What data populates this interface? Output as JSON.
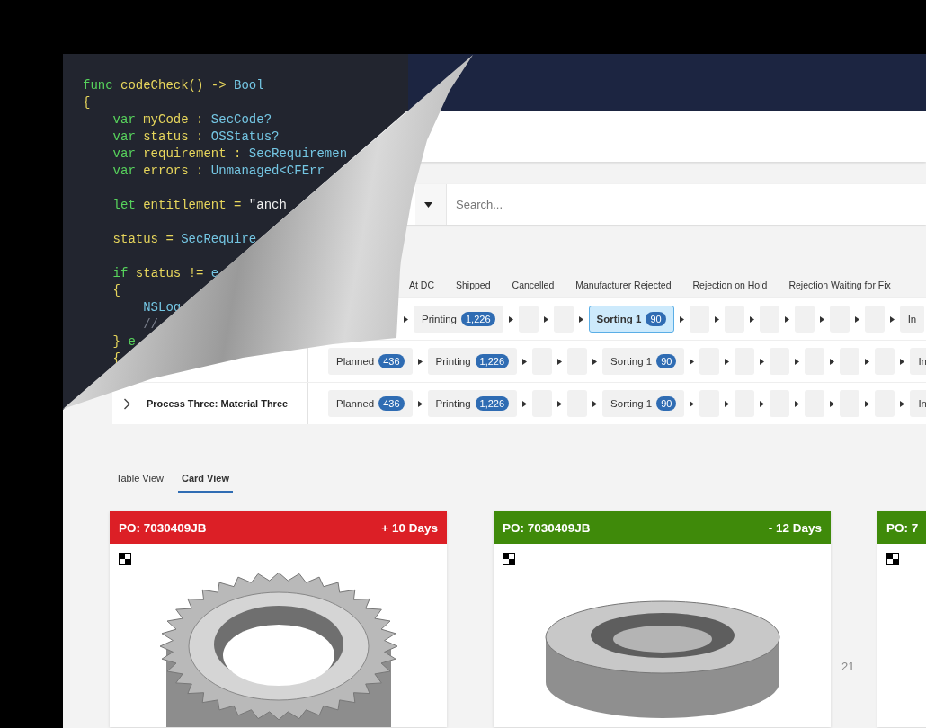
{
  "code_lines": [
    {
      "tokens": [
        {
          "text": "func",
          "kind": "keyword"
        },
        {
          "text": " codeCheck() -> ",
          "kind": "ident"
        },
        {
          "text": "Bool",
          "kind": "type"
        }
      ]
    },
    {
      "tokens": [
        {
          "text": "{",
          "kind": "ident"
        }
      ]
    },
    {
      "tokens": [
        {
          "text": "    var",
          "kind": "keyword"
        },
        {
          "text": " myCode : ",
          "kind": "ident"
        },
        {
          "text": "SecCode?",
          "kind": "type"
        }
      ]
    },
    {
      "tokens": [
        {
          "text": "    var",
          "kind": "keyword"
        },
        {
          "text": " status : ",
          "kind": "ident"
        },
        {
          "text": "OSStatus?",
          "kind": "type"
        }
      ]
    },
    {
      "tokens": [
        {
          "text": "    var",
          "kind": "keyword"
        },
        {
          "text": " requirement : ",
          "kind": "ident"
        },
        {
          "text": "SecRequiremen",
          "kind": "type"
        }
      ]
    },
    {
      "tokens": [
        {
          "text": "    var",
          "kind": "keyword"
        },
        {
          "text": " errors : ",
          "kind": "ident"
        },
        {
          "text": "Unmanaged<CFErr",
          "kind": "type"
        }
      ]
    },
    {
      "blank_before": true,
      "tokens": [
        {
          "text": "    let",
          "kind": "keyword"
        },
        {
          "text": " entitlement = ",
          "kind": "ident"
        },
        {
          "text": "\"anch",
          "kind": "plain"
        }
      ]
    },
    {
      "blank_before": true,
      "tokens": [
        {
          "text": "    status = ",
          "kind": "ident"
        },
        {
          "text": "SecRequire",
          "kind": "type"
        }
      ]
    },
    {
      "blank_before": true,
      "tokens": [
        {
          "text": "    if",
          "kind": "keyword"
        },
        {
          "text": " status != ",
          "kind": "ident"
        },
        {
          "text": "e",
          "kind": "type"
        }
      ]
    },
    {
      "tokens": [
        {
          "text": "    {",
          "kind": "ident"
        }
      ]
    },
    {
      "tokens": [
        {
          "text": "        NSLog",
          "kind": "type"
        }
      ]
    },
    {
      "tokens": [
        {
          "text": "        //",
          "kind": "comment"
        }
      ]
    },
    {
      "tokens": [
        {
          "text": "    }",
          "kind": "ident"
        },
        {
          "text": " e",
          "kind": "keyword"
        }
      ]
    },
    {
      "tokens": [
        {
          "text": "    {",
          "kind": "ident"
        }
      ]
    }
  ],
  "search": {
    "placeholder": "Search..."
  },
  "stage_headers": [
    "At DC",
    "Shipped",
    "Cancelled",
    "Manufacturer Rejected",
    "Rejection on Hold",
    "Rejection Waiting for Fix"
  ],
  "process_rows": [
    {
      "stages": [
        {
          "kind": "covered"
        },
        {
          "kind": "stage",
          "label": "Printing",
          "count": "1,226",
          "selected": false
        },
        {
          "kind": "empty",
          "selected": false
        },
        {
          "kind": "empty",
          "selected": false
        },
        {
          "kind": "stage",
          "label": "Sorting 1",
          "count": "90",
          "selected": true
        },
        {
          "kind": "empty",
          "selected": false
        },
        {
          "kind": "empty",
          "selected": false
        },
        {
          "kind": "empty",
          "selected": false
        },
        {
          "kind": "empty",
          "selected": false
        },
        {
          "kind": "empty",
          "selected": false
        },
        {
          "kind": "empty",
          "selected": false
        },
        {
          "kind": "stage",
          "label": "In",
          "selected": false
        }
      ]
    },
    {
      "stages": [
        {
          "kind": "stage",
          "label": "Planned",
          "count": "436",
          "selected": false
        },
        {
          "kind": "stage",
          "label": "Printing",
          "count": "1,226",
          "selected": false
        },
        {
          "kind": "empty",
          "selected": false
        },
        {
          "kind": "empty",
          "selected": false
        },
        {
          "kind": "stage",
          "label": "Sorting 1",
          "count": "90",
          "selected": false
        },
        {
          "kind": "empty",
          "selected": false
        },
        {
          "kind": "empty",
          "selected": false
        },
        {
          "kind": "empty",
          "selected": false
        },
        {
          "kind": "empty",
          "selected": false
        },
        {
          "kind": "empty",
          "selected": false
        },
        {
          "kind": "empty",
          "selected": false
        },
        {
          "kind": "stage",
          "label": "In",
          "selected": false
        }
      ]
    },
    {
      "label": "Process Three: Material Three",
      "expanded": false,
      "stages": [
        {
          "kind": "stage",
          "label": "Planned",
          "count": "436",
          "selected": false
        },
        {
          "kind": "stage",
          "label": "Printing",
          "count": "1,226",
          "selected": false
        },
        {
          "kind": "empty",
          "selected": false
        },
        {
          "kind": "empty",
          "selected": false
        },
        {
          "kind": "stage",
          "label": "Sorting 1",
          "count": "90",
          "selected": false
        },
        {
          "kind": "empty",
          "selected": false
        },
        {
          "kind": "empty",
          "selected": false
        },
        {
          "kind": "empty",
          "selected": false
        },
        {
          "kind": "empty",
          "selected": false
        },
        {
          "kind": "empty",
          "selected": false
        },
        {
          "kind": "empty",
          "selected": false
        },
        {
          "kind": "stage",
          "label": "In",
          "selected": false
        }
      ]
    }
  ],
  "view_tabs": [
    {
      "label": "Table View",
      "selected": false
    },
    {
      "label": "Card View",
      "selected": true
    }
  ],
  "cards": [
    {
      "po": "PO: 7030409JB",
      "days": "+ 10 Days",
      "color": "#dc1f26",
      "kind": "gear"
    },
    {
      "po": "PO: 7030409JB",
      "days": "- 12 Days",
      "color": "#3f8a0a",
      "kind": "ring"
    },
    {
      "po": "PO: 7",
      "color": "#3f8a0a"
    }
  ],
  "page_number": "21"
}
